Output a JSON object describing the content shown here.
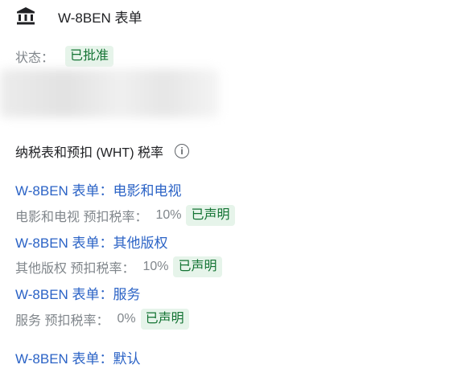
{
  "header": {
    "title": "W-8BEN 表单",
    "icon": "bank-icon"
  },
  "status": {
    "label": "状态：",
    "value": "已批准"
  },
  "section": {
    "title": "纳税表和预扣 (WHT) 税率",
    "info_icon": "info-icon"
  },
  "forms": [
    {
      "link": "W-8BEN 表单：电影和电视",
      "rate_label": "电影和电视 预扣税率：",
      "rate": "10%",
      "badge": "已声明"
    },
    {
      "link": "W-8BEN 表单：其他版权",
      "rate_label": "其他版权 预扣税率：",
      "rate": "10%",
      "badge": "已声明"
    },
    {
      "link": "W-8BEN 表单：服务",
      "rate_label": "服务 预扣税率：",
      "rate": "0%",
      "badge": "已声明"
    },
    {
      "link": "W-8BEN 表单：默认"
    }
  ],
  "colors": {
    "link": "#2b63c6",
    "badge_bg": "#e6f4ea",
    "badge_text": "#137333",
    "muted": "#80868b"
  }
}
